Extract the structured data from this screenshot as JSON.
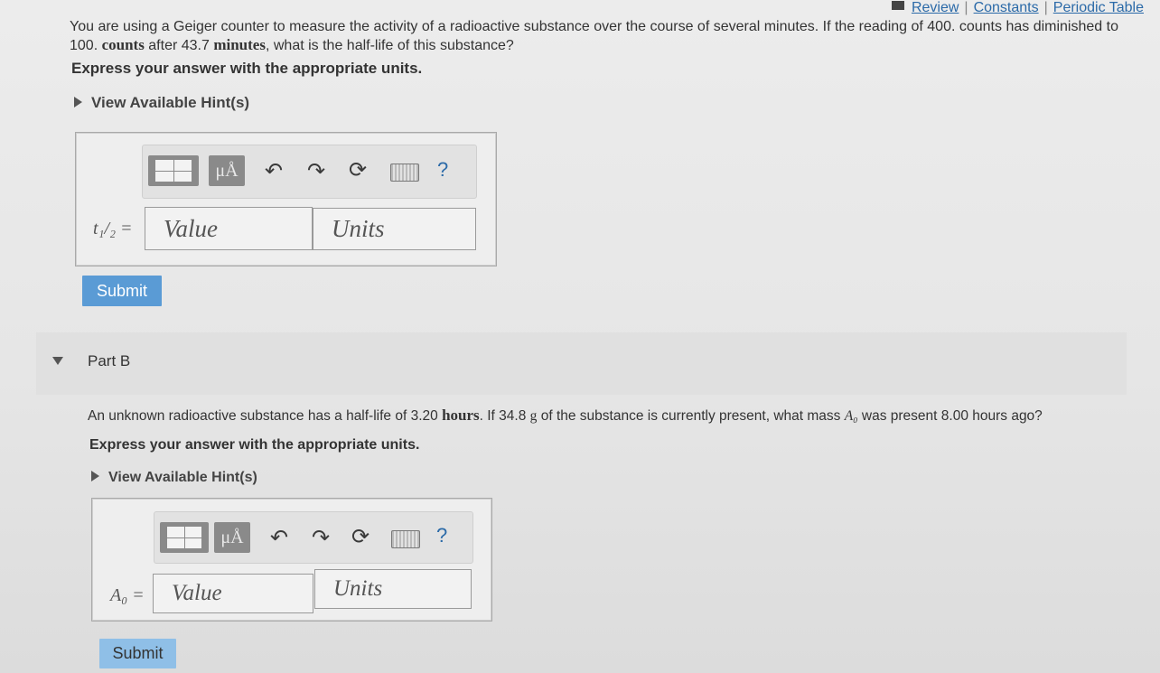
{
  "links": {
    "review": "Review",
    "constants": "Constants",
    "periodic": "Periodic Table",
    "separator": "|"
  },
  "partA": {
    "q_line1": "You are using a Geiger counter to measure the activity of a radioactive substance over the course of several minutes. If the reading of 400. counts has diminished to",
    "q_line2_a": "100.",
    "q_line2_unit1": "counts",
    "q_line2_b": "after 43.7",
    "q_line2_unit2": "minutes",
    "q_line2_c": ", what is the half-life of this substance?",
    "express": "Express your answer with the appropriate units.",
    "hint": "View Available Hint(s)",
    "var_label": "t₁/₂ =",
    "value_placeholder": "Value",
    "units_placeholder": "Units",
    "submit": "Submit",
    "toolbar": {
      "mu": "μÅ",
      "help": "?"
    }
  },
  "partB": {
    "title": "Part B",
    "q_a": "An unknown radioactive substance has a half-life of 3.20",
    "q_unit1": "hours",
    "q_b": ". If 34.8",
    "q_unit2": "g",
    "q_c": "of the substance is currently present, what mass",
    "q_var": "A₀",
    "q_d": "was present 8.00 hours ago?",
    "express": "Express your answer with the appropriate units.",
    "hint": "View Available Hint(s)",
    "var_label": "A₀ =",
    "value_placeholder": "Value",
    "units_placeholder": "Units",
    "submit": "Submit",
    "toolbar": {
      "mu": "μÅ",
      "help": "?"
    }
  }
}
